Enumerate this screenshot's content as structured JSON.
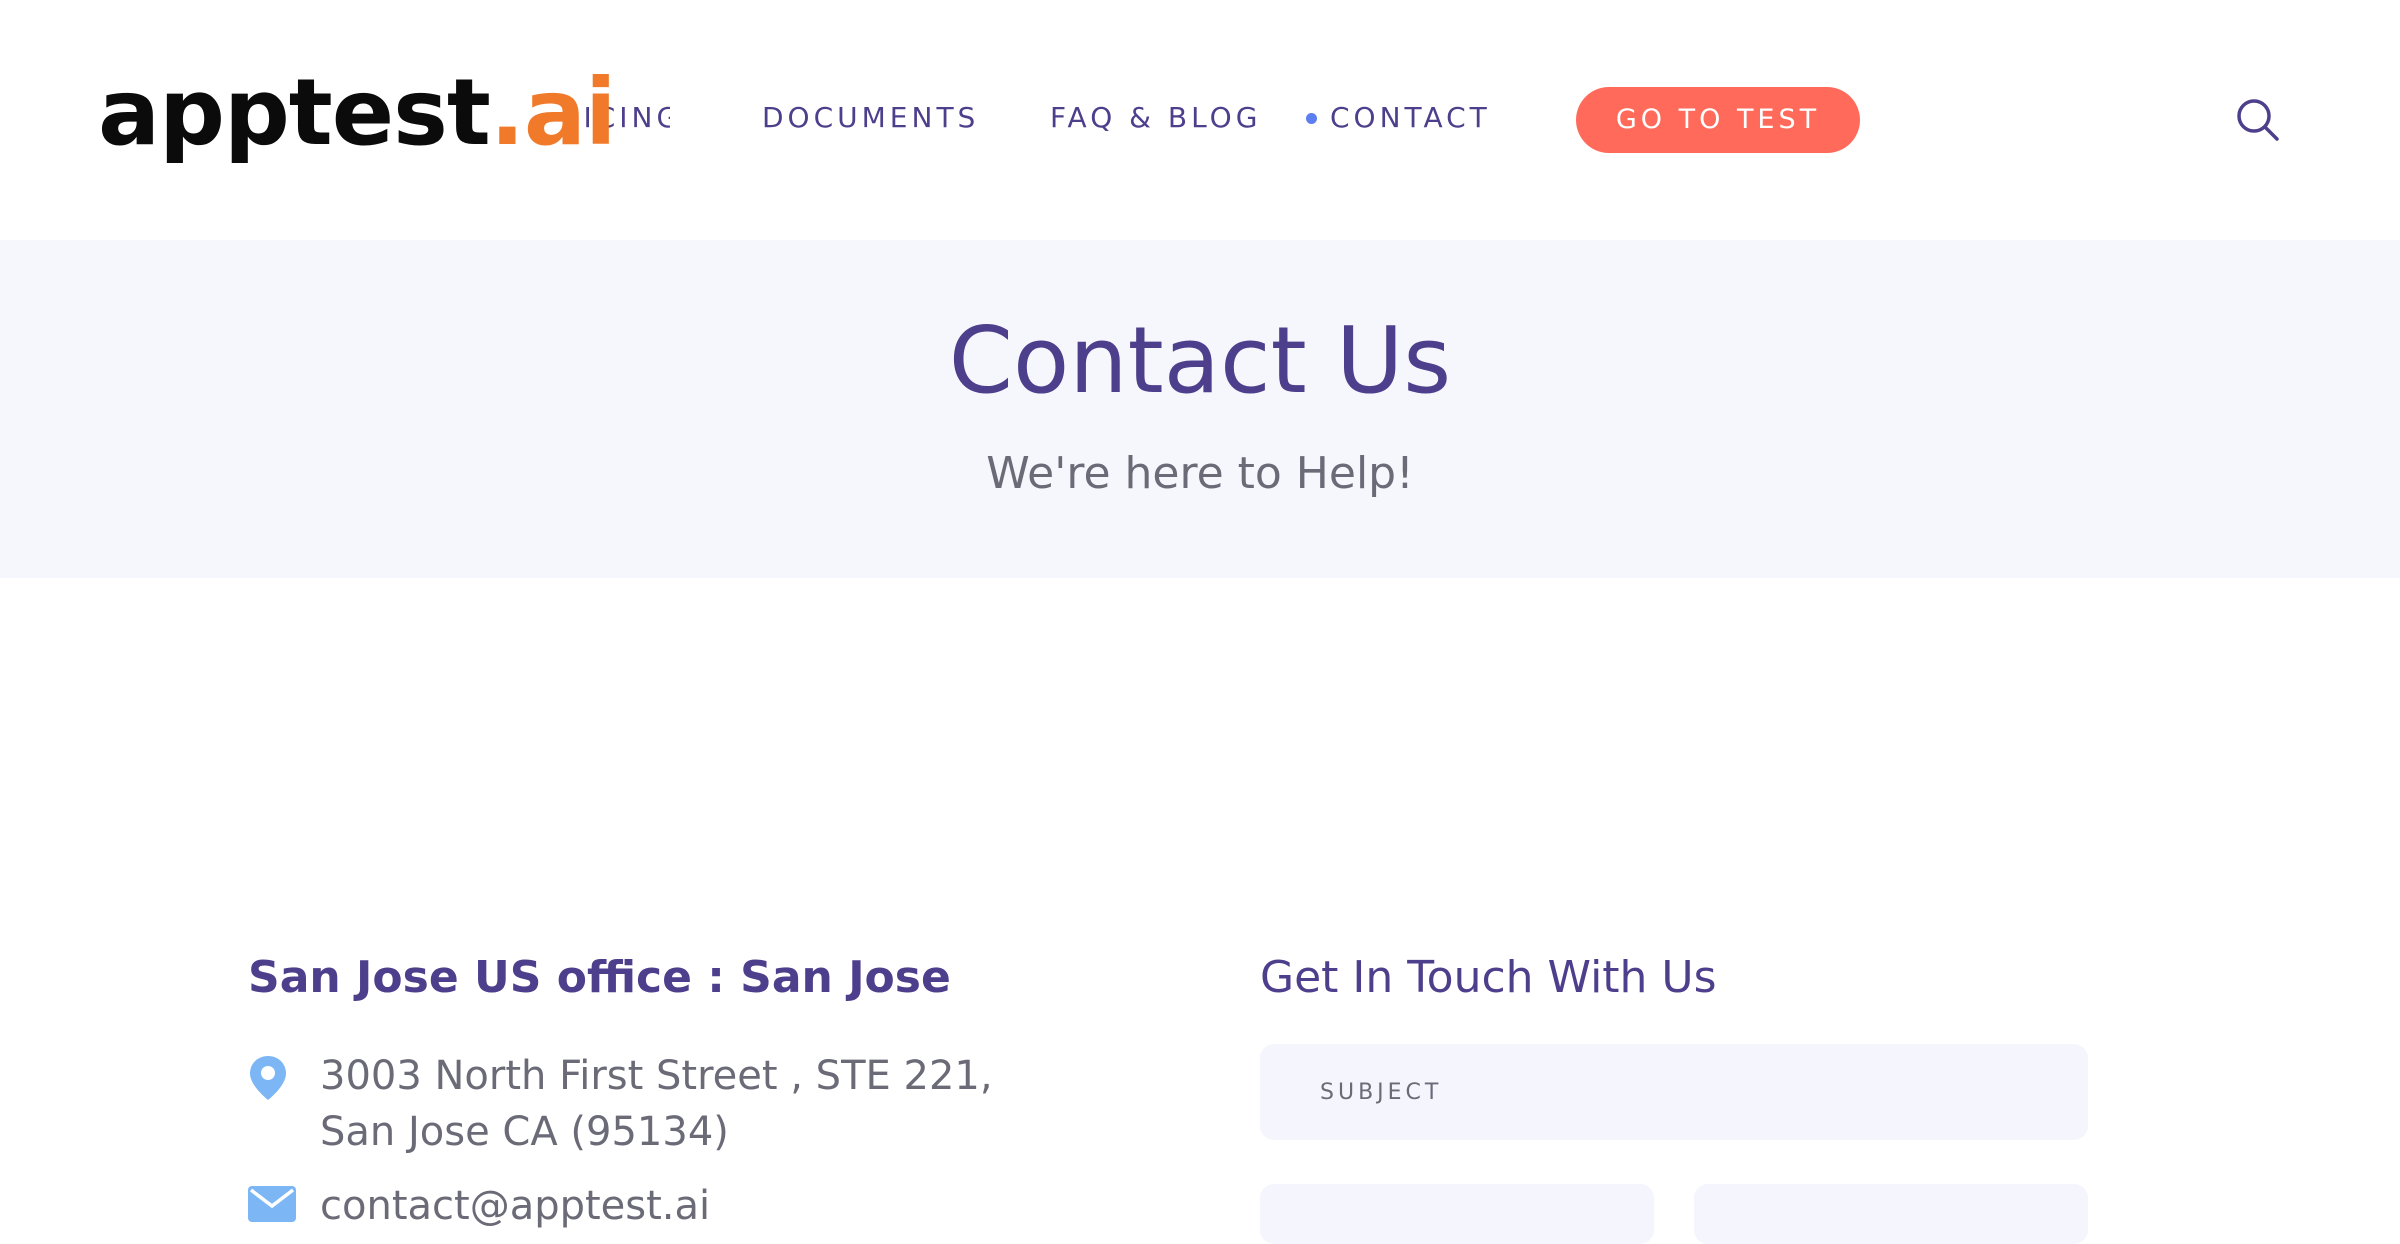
{
  "header": {
    "logo": {
      "main": "apptest",
      "accent": ".ai"
    },
    "nav": {
      "pricing": "RICING",
      "documents": "DOCUMENTS",
      "faq_blog": "FAQ & BLOG",
      "contact": "CONTACT"
    },
    "active_item": "contact",
    "cta_label": "GO TO TEST",
    "search_icon": "search-icon"
  },
  "hero": {
    "title": "Contact Us",
    "subtitle": "We're here to Help!"
  },
  "office": {
    "title": "San Jose US office : San Jose",
    "address": "3003 North First Street , STE 221, San Jose CA (95134)",
    "address_icon": "map-pin-icon",
    "email": "contact@apptest.ai",
    "email_icon": "envelope-icon"
  },
  "form": {
    "title": "Get In Touch With Us",
    "subject_placeholder": "SUBJECT"
  },
  "colors": {
    "brand_purple": "#4e3f8c",
    "accent_orange": "#f07a2a",
    "cta_coral": "#ff6a5b",
    "active_dot": "#5b7ef0",
    "icon_blue": "#7cb6f5",
    "hero_bg": "#f5f7fd",
    "body_text": "#6b6b78"
  }
}
